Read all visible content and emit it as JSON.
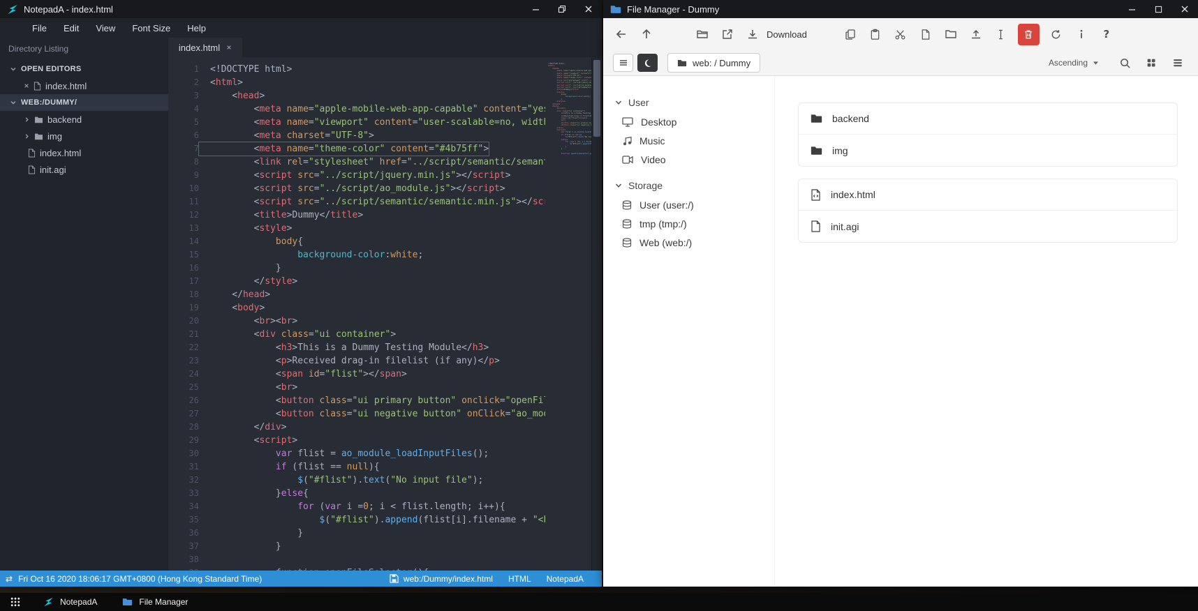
{
  "notepad": {
    "title": "NotepadA - index.html",
    "menu": [
      "File",
      "Edit",
      "View",
      "Font Size",
      "Help"
    ],
    "sidebar": {
      "header": "Directory Listing",
      "open_editors_label": "OPEN EDITORS",
      "open_editor_file": "index.html",
      "workspace_label": "WEB:/DUMMY/",
      "tree": [
        {
          "name": "backend",
          "type": "folder"
        },
        {
          "name": "img",
          "type": "folder"
        },
        {
          "name": "index.html",
          "type": "file"
        },
        {
          "name": "init.agi",
          "type": "file"
        }
      ]
    },
    "tab": "index.html",
    "active_line": 7,
    "statusbar": {
      "datetime": "Fri Oct 16 2020 18:06:17 GMT+0800 (Hong Kong Standard Time)",
      "file_path": "web:/Dummy/index.html",
      "language": "HTML",
      "app_name": "NotepadA"
    },
    "code_lines": [
      [
        [
          "pln",
          "<!DOCTYPE html>"
        ]
      ],
      [
        [
          "pln",
          "<"
        ],
        [
          "tag",
          "html"
        ],
        [
          "pln",
          ">"
        ]
      ],
      [
        [
          "pln",
          "    <"
        ],
        [
          "tag",
          "head"
        ],
        [
          "pln",
          ">"
        ]
      ],
      [
        [
          "pln",
          "        <"
        ],
        [
          "tag",
          "meta"
        ],
        [
          "pln",
          " "
        ],
        [
          "attr",
          "name"
        ],
        [
          "pln",
          "="
        ],
        [
          "str",
          "\"apple-mobile-web-app-capable\""
        ],
        [
          "pln",
          " "
        ],
        [
          "attr",
          "content"
        ],
        [
          "pln",
          "="
        ],
        [
          "str",
          "\"yes\""
        ],
        [
          "pln",
          ">"
        ]
      ],
      [
        [
          "pln",
          "        <"
        ],
        [
          "tag",
          "meta"
        ],
        [
          "pln",
          " "
        ],
        [
          "attr",
          "name"
        ],
        [
          "pln",
          "="
        ],
        [
          "str",
          "\"viewport\""
        ],
        [
          "pln",
          " "
        ],
        [
          "attr",
          "content"
        ],
        [
          "pln",
          "="
        ],
        [
          "str",
          "\"user-scalable=no, width=device-width\""
        ],
        [
          "pln",
          ">"
        ]
      ],
      [
        [
          "pln",
          "        <"
        ],
        [
          "tag",
          "meta"
        ],
        [
          "pln",
          " "
        ],
        [
          "attr",
          "charset"
        ],
        [
          "pln",
          "="
        ],
        [
          "str",
          "\"UTF-8\""
        ],
        [
          "pln",
          ">"
        ]
      ],
      [
        [
          "pln",
          "        <"
        ],
        [
          "tag",
          "meta"
        ],
        [
          "pln",
          " "
        ],
        [
          "attr",
          "name"
        ],
        [
          "pln",
          "="
        ],
        [
          "str",
          "\"theme-color\""
        ],
        [
          "pln",
          " "
        ],
        [
          "attr",
          "content"
        ],
        [
          "pln",
          "="
        ],
        [
          "str",
          "\"#4b75ff\""
        ],
        [
          "pln",
          ">"
        ]
      ],
      [
        [
          "pln",
          "        <"
        ],
        [
          "tag",
          "link"
        ],
        [
          "pln",
          " "
        ],
        [
          "attr",
          "rel"
        ],
        [
          "pln",
          "="
        ],
        [
          "str",
          "\"stylesheet\""
        ],
        [
          "pln",
          " "
        ],
        [
          "attr",
          "href"
        ],
        [
          "pln",
          "="
        ],
        [
          "str",
          "\"../script/semantic/semantic.min.css\""
        ],
        [
          "pln",
          ">"
        ]
      ],
      [
        [
          "pln",
          "        <"
        ],
        [
          "tag",
          "script"
        ],
        [
          "pln",
          " "
        ],
        [
          "attr",
          "src"
        ],
        [
          "pln",
          "="
        ],
        [
          "str",
          "\"../script/jquery.min.js\""
        ],
        [
          "pln",
          "></"
        ],
        [
          "tag",
          "script"
        ],
        [
          "pln",
          ">"
        ]
      ],
      [
        [
          "pln",
          "        <"
        ],
        [
          "tag",
          "script"
        ],
        [
          "pln",
          " "
        ],
        [
          "attr",
          "src"
        ],
        [
          "pln",
          "="
        ],
        [
          "str",
          "\"../script/ao_module.js\""
        ],
        [
          "pln",
          "></"
        ],
        [
          "tag",
          "script"
        ],
        [
          "pln",
          ">"
        ]
      ],
      [
        [
          "pln",
          "        <"
        ],
        [
          "tag",
          "script"
        ],
        [
          "pln",
          " "
        ],
        [
          "attr",
          "src"
        ],
        [
          "pln",
          "="
        ],
        [
          "str",
          "\"../script/semantic/semantic.min.js\""
        ],
        [
          "pln",
          "></"
        ],
        [
          "tag",
          "script"
        ],
        [
          "pln",
          ">"
        ]
      ],
      [
        [
          "pln",
          "        <"
        ],
        [
          "tag",
          "title"
        ],
        [
          "pln",
          ">Dummy</"
        ],
        [
          "tag",
          "title"
        ],
        [
          "pln",
          ">"
        ]
      ],
      [
        [
          "pln",
          "        <"
        ],
        [
          "tag",
          "style"
        ],
        [
          "pln",
          ">"
        ]
      ],
      [
        [
          "pln",
          "            "
        ],
        [
          "attr",
          "body"
        ],
        [
          "pln",
          "{"
        ]
      ],
      [
        [
          "pln",
          "                "
        ],
        [
          "prop",
          "background-color"
        ],
        [
          "pln",
          ":"
        ],
        [
          "attr",
          "white"
        ],
        [
          "pln",
          ";"
        ]
      ],
      [
        [
          "pln",
          "            }"
        ]
      ],
      [
        [
          "pln",
          "        </"
        ],
        [
          "tag",
          "style"
        ],
        [
          "pln",
          ">"
        ]
      ],
      [
        [
          "pln",
          "    </"
        ],
        [
          "tag",
          "head"
        ],
        [
          "pln",
          ">"
        ]
      ],
      [
        [
          "pln",
          "    <"
        ],
        [
          "tag",
          "body"
        ],
        [
          "pln",
          ">"
        ]
      ],
      [
        [
          "pln",
          "        <"
        ],
        [
          "tag",
          "br"
        ],
        [
          "pln",
          "><"
        ],
        [
          "tag",
          "br"
        ],
        [
          "pln",
          ">"
        ]
      ],
      [
        [
          "pln",
          "        <"
        ],
        [
          "tag",
          "div"
        ],
        [
          "pln",
          " "
        ],
        [
          "attr",
          "class"
        ],
        [
          "pln",
          "="
        ],
        [
          "str",
          "\"ui container\""
        ],
        [
          "pln",
          ">"
        ]
      ],
      [
        [
          "pln",
          "            <"
        ],
        [
          "tag",
          "h3"
        ],
        [
          "pln",
          ">This is a Dummy Testing Module</"
        ],
        [
          "tag",
          "h3"
        ],
        [
          "pln",
          ">"
        ]
      ],
      [
        [
          "pln",
          "            <"
        ],
        [
          "tag",
          "p"
        ],
        [
          "pln",
          ">Received drag-in filelist (if any)</"
        ],
        [
          "tag",
          "p"
        ],
        [
          "pln",
          ">"
        ]
      ],
      [
        [
          "pln",
          "            <"
        ],
        [
          "tag",
          "span"
        ],
        [
          "pln",
          " "
        ],
        [
          "attr",
          "id"
        ],
        [
          "pln",
          "="
        ],
        [
          "str",
          "\"flist\""
        ],
        [
          "pln",
          "></"
        ],
        [
          "tag",
          "span"
        ],
        [
          "pln",
          ">"
        ]
      ],
      [
        [
          "pln",
          "            <"
        ],
        [
          "tag",
          "br"
        ],
        [
          "pln",
          ">"
        ]
      ],
      [
        [
          "pln",
          "            <"
        ],
        [
          "tag",
          "button"
        ],
        [
          "pln",
          " "
        ],
        [
          "attr",
          "class"
        ],
        [
          "pln",
          "="
        ],
        [
          "str",
          "\"ui primary button\""
        ],
        [
          "pln",
          " "
        ],
        [
          "attr",
          "onclick"
        ],
        [
          "pln",
          "="
        ],
        [
          "str",
          "\"openFileSelector()\""
        ],
        [
          "pln",
          ">"
        ]
      ],
      [
        [
          "pln",
          "            <"
        ],
        [
          "tag",
          "button"
        ],
        [
          "pln",
          " "
        ],
        [
          "attr",
          "class"
        ],
        [
          "pln",
          "="
        ],
        [
          "str",
          "\"ui negative button\""
        ],
        [
          "pln",
          " "
        ],
        [
          "attr",
          "onClick"
        ],
        [
          "pln",
          "="
        ],
        [
          "str",
          "\"ao_module_close()\""
        ],
        [
          "pln",
          ">"
        ]
      ],
      [
        [
          "pln",
          "        </"
        ],
        [
          "tag",
          "div"
        ],
        [
          "pln",
          ">"
        ]
      ],
      [
        [
          "pln",
          "        <"
        ],
        [
          "tag",
          "script"
        ],
        [
          "pln",
          ">"
        ]
      ],
      [
        [
          "pln",
          "            "
        ],
        [
          "kw",
          "var"
        ],
        [
          "pln",
          " flist = "
        ],
        [
          "fn",
          "ao_module_loadInputFiles"
        ],
        [
          "pln",
          "();"
        ]
      ],
      [
        [
          "pln",
          "            "
        ],
        [
          "kw",
          "if"
        ],
        [
          "pln",
          " (flist == "
        ],
        [
          "num",
          "null"
        ],
        [
          "pln",
          "){"
        ]
      ],
      [
        [
          "pln",
          "                "
        ],
        [
          "fn",
          "$"
        ],
        [
          "pln",
          "("
        ],
        [
          "str",
          "\"#flist\""
        ],
        [
          "pln",
          ")."
        ],
        [
          "fn",
          "text"
        ],
        [
          "pln",
          "("
        ],
        [
          "str",
          "\"No input file\""
        ],
        [
          "pln",
          ");"
        ]
      ],
      [
        [
          "pln",
          "            }"
        ],
        [
          "kw",
          "else"
        ],
        [
          "pln",
          "{"
        ]
      ],
      [
        [
          "pln",
          "                "
        ],
        [
          "kw",
          "for"
        ],
        [
          "pln",
          " ("
        ],
        [
          "kw",
          "var"
        ],
        [
          "pln",
          " i ="
        ],
        [
          "num",
          "0"
        ],
        [
          "pln",
          "; i < flist.length; i++){"
        ]
      ],
      [
        [
          "pln",
          "                    "
        ],
        [
          "fn",
          "$"
        ],
        [
          "pln",
          "("
        ],
        [
          "str",
          "\"#flist\""
        ],
        [
          "pln",
          ")."
        ],
        [
          "fn",
          "append"
        ],
        [
          "pln",
          "(flist[i].filename + "
        ],
        [
          "str",
          "\"<br>\""
        ],
        [
          "pln",
          ");"
        ]
      ],
      [
        [
          "pln",
          "                }"
        ]
      ],
      [
        [
          "pln",
          "            }"
        ]
      ],
      [
        [
          "pln",
          ""
        ]
      ],
      [
        [
          "pln",
          "            "
        ],
        [
          "kw",
          "function"
        ],
        [
          "pln",
          " "
        ],
        [
          "fn",
          "openFileSelector"
        ],
        [
          "pln",
          "(){"
        ]
      ]
    ]
  },
  "filemanager": {
    "title": "File Manager - Dummy",
    "toolbar": {
      "download_label": "Download",
      "sort_order": "Ascending"
    },
    "breadcrumb": "web: / Dummy",
    "sidebar": [
      {
        "label": "User",
        "items": [
          {
            "name": "Desktop",
            "icon": "desktop-icon"
          },
          {
            "name": "Music",
            "icon": "music-icon"
          },
          {
            "name": "Video",
            "icon": "video-icon"
          }
        ]
      },
      {
        "label": "Storage",
        "items": [
          {
            "name": "User (user:/)",
            "icon": "drive-icon"
          },
          {
            "name": "tmp (tmp:/)",
            "icon": "drive-icon"
          },
          {
            "name": "Web (web:/)",
            "icon": "drive-icon"
          }
        ]
      }
    ],
    "file_groups": [
      {
        "items": [
          {
            "name": "backend",
            "icon": "folder-icon"
          },
          {
            "name": "img",
            "icon": "folder-icon"
          }
        ]
      },
      {
        "items": [
          {
            "name": "index.html",
            "icon": "file-code-icon"
          },
          {
            "name": "init.agi",
            "icon": "file-icon"
          }
        ]
      }
    ]
  },
  "taskbar": {
    "items": [
      {
        "label": "NotepadA",
        "icon": "notepada-icon"
      },
      {
        "label": "File Manager",
        "icon": "folder-icon"
      }
    ]
  },
  "icons": {
    "exchange": "⇄",
    "help": "?"
  },
  "colors": {
    "statusbar_blue": "#2e8fd6",
    "danger_red": "#d9453c",
    "brand_cyan": "#1ac3d8",
    "folder_blue": "#4a8fd4",
    "editor_bg": "#282c34",
    "panel_bg": "#21252b"
  }
}
